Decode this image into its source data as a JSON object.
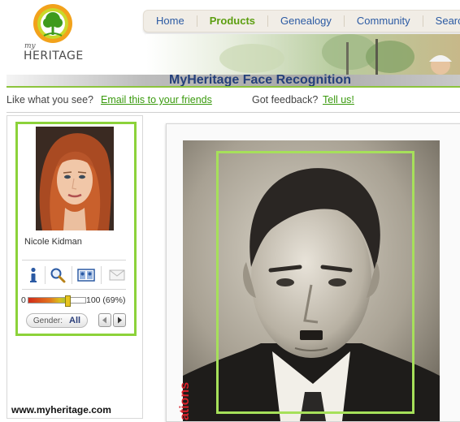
{
  "logo": {
    "small": "my",
    "word": "HERITAGE",
    "icon": "tree-logo-icon"
  },
  "nav": {
    "items": [
      "Home",
      "Products",
      "Genealogy",
      "Community",
      "Search"
    ],
    "active": "Products"
  },
  "page": {
    "title": "MyHeritage Face Recognition"
  },
  "share": {
    "prompt": "Like what you see?",
    "link": "Email this to your friends"
  },
  "feedback": {
    "prompt": "Got feedback?",
    "link": "Tell us!"
  },
  "match": {
    "name": "Nicole Kidman",
    "score_min": "0",
    "score_max": "100 (69%)",
    "score_value": 69,
    "tools": [
      "info-icon",
      "magnify-icon",
      "compare-faces-icon",
      "envelope-icon"
    ],
    "gender_label": "Gender:",
    "gender_value": "All"
  },
  "footer": {
    "url": "www.myheritage.com"
  },
  "photo": {
    "caption_fragment": "ations"
  },
  "colors": {
    "accent_green": "#8cd23a",
    "nav_link": "#2b5aa3",
    "active_green": "#5c9e10",
    "title_blue": "#25407a"
  }
}
